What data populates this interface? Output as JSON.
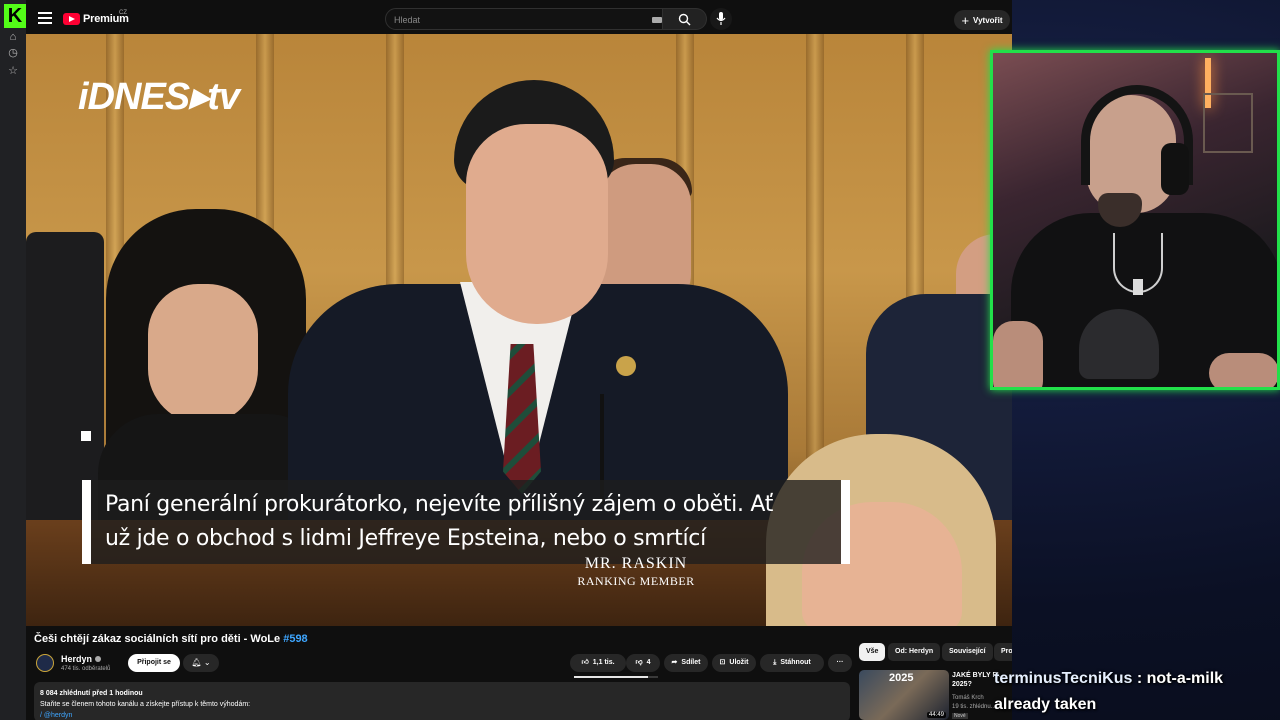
{
  "kick": {
    "logo": "K",
    "icons": [
      "home-icon",
      "history-icon",
      "star-icon"
    ]
  },
  "youtube": {
    "logo_text": "Premium",
    "region": "CZ",
    "search": {
      "placeholder": "Hledat"
    },
    "create_label": "Vytvořit"
  },
  "video": {
    "watermark": "iDNES▸tv",
    "subtitle_line1": "Paní generální prokurátorko, nejevíte přílišný zájem o oběti. Ať",
    "subtitle_line2": "už jde o obchod s lidmi Jeffreye Epsteina, nebo o smrtící",
    "nameplate_name": "MR. RASKIN",
    "nameplate_role": "RANKING MEMBER"
  },
  "meta": {
    "title": "Češi chtějí zákaz sociálních sítí pro děti - WoLe ",
    "title_tag": "#598",
    "channel_name": "Herdyn",
    "channel_subs": "474 tis. odběratelů",
    "join_label": "Připojit se",
    "likes": "1,1 tis.",
    "like_ratio": 0.88,
    "dislikes": "4",
    "share_label": "Sdílet",
    "save_label": "Uložit",
    "download_label": "Stáhnout",
    "more_label": "···",
    "description_stats": "8 084 zhlédnutí  před 1 hodinou",
    "description_line": "Staňte se členem tohoto kanálu a získejte přístup k těmto výhodám:",
    "description_link": "/ @herdyn"
  },
  "chips": [
    "Vše",
    "Od: Herdyn",
    "Související",
    "Pro"
  ],
  "recommendation": {
    "thumb_year": "2025",
    "duration": "44:49",
    "title": "JAKÉ BYLY FI... 2025?",
    "channel": "Tomáš Krch",
    "meta": "19 tis. zhlédnu...",
    "badge": "Nové"
  },
  "chat": {
    "username": "terminusTecniKus",
    "separator": " : ",
    "message": "not-a-milk already taken"
  },
  "colors": {
    "kick_green": "#53fc18",
    "youtube_red": "#ff0033",
    "webcam_border": "#22e04a",
    "link_blue": "#3ea6ff"
  }
}
